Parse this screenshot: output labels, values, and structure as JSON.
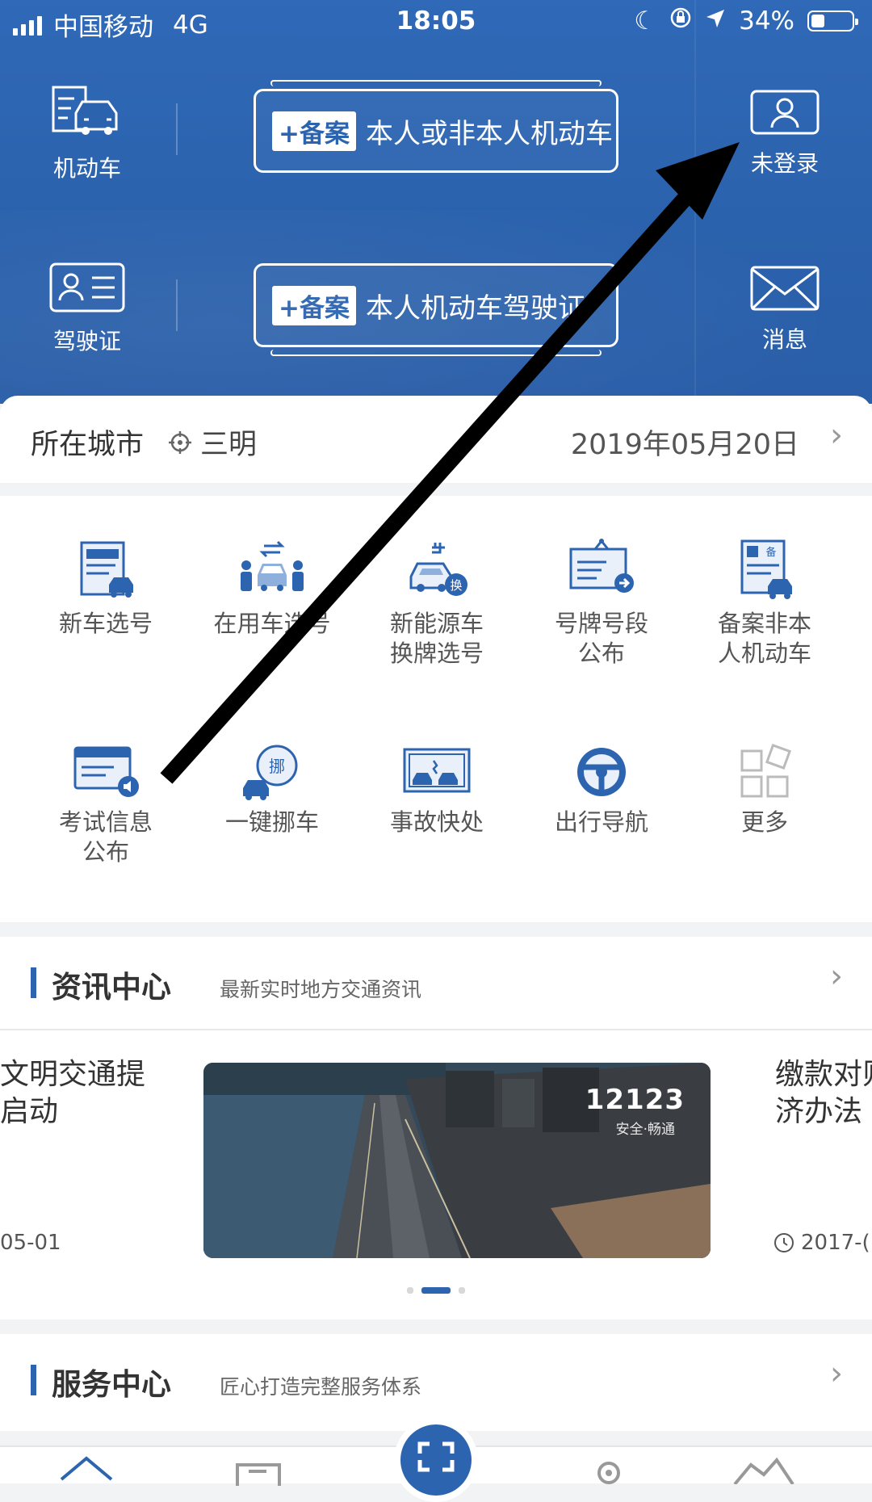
{
  "status_bar": {
    "carrier": "中国移动",
    "network": "4G",
    "time": "18:05",
    "battery_text": "34%",
    "battery_level": 0.34
  },
  "header": {
    "vehicle_label": "机动车",
    "license_label": "驾驶证",
    "login_label": "未登录",
    "message_label": "消息",
    "plate_vehicle": {
      "tag": "+备案",
      "text": "本人或非本人机动车"
    },
    "plate_license": {
      "tag": "+备案",
      "text": "本人机动车驾驶证"
    }
  },
  "city": {
    "title": "所在城市",
    "city_name": "三明",
    "date": "2019年05月20日"
  },
  "services_grid": [
    {
      "l1": "新车选号",
      "l2": ""
    },
    {
      "l1": "在用车选号",
      "l2": ""
    },
    {
      "l1": "新能源车",
      "l2": "换牌选号"
    },
    {
      "l1": "号牌号段",
      "l2": "公布"
    },
    {
      "l1": "备案非本",
      "l2": "人机动车"
    },
    {
      "l1": "考试信息",
      "l2": "公布"
    },
    {
      "l1": "一键挪车",
      "l2": ""
    },
    {
      "l1": "事故快处",
      "l2": ""
    },
    {
      "l1": "出行导航",
      "l2": ""
    },
    {
      "l1": "更多",
      "l2": ""
    }
  ],
  "news": {
    "title": "资讯中心",
    "subtitle": "最新实时地方交通资讯",
    "left_line1": "文明交通提",
    "left_line2": "启动",
    "left_date": "05-01",
    "right_line1": "缴款对则",
    "right_line2": "济办法",
    "right_date": "2017-(",
    "image_brand": "12123",
    "image_slogan": "安全·畅通"
  },
  "service_center": {
    "title": "服务中心",
    "subtitle": "匠心打造完整服务体系"
  },
  "colors": {
    "brand": "#2d64b0",
    "header": "#2c63ae"
  }
}
